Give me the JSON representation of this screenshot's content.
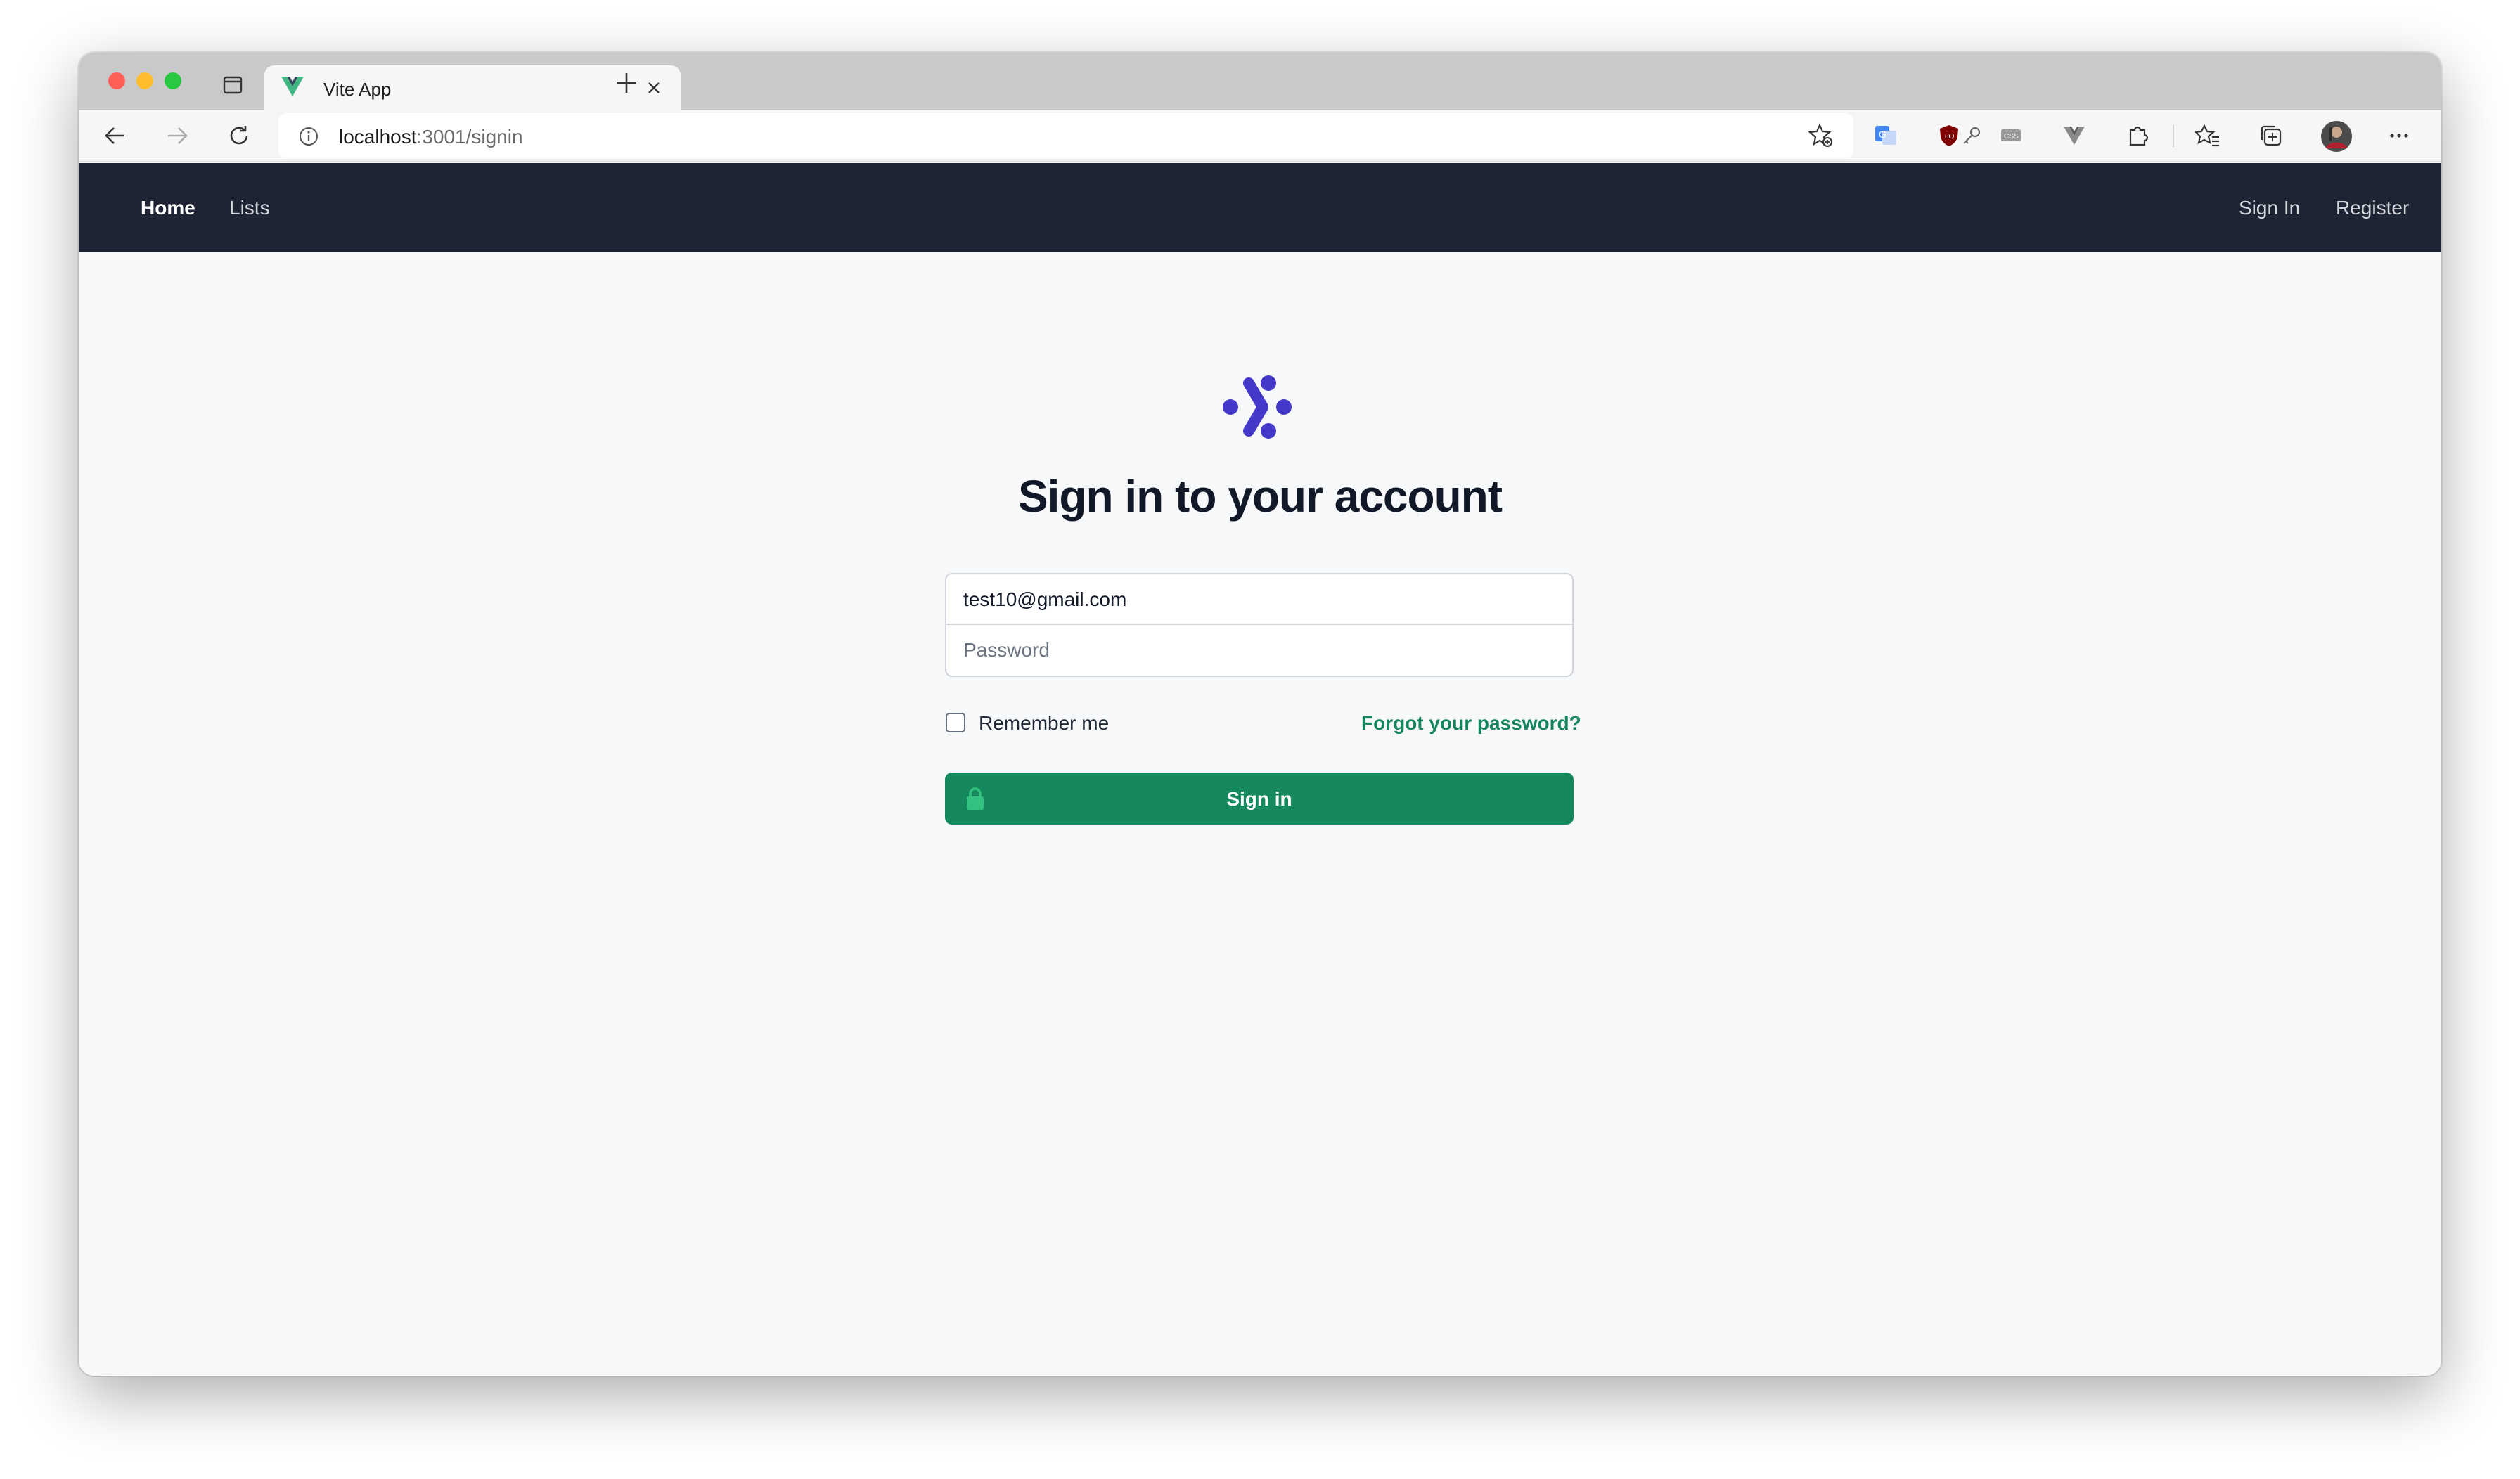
{
  "browser": {
    "tab": {
      "title": "Vite App"
    },
    "address": {
      "host": "localhost",
      "path": ":3001/signin"
    }
  },
  "navbar": {
    "home": "Home",
    "lists": "Lists",
    "sign_in": "Sign In",
    "register": "Register"
  },
  "signin": {
    "heading": "Sign in to your account",
    "email_value": "test10@gmail.com",
    "password_placeholder": "Password",
    "remember_label": "Remember me",
    "remember_checked": false,
    "forgot_link": "Forgot your password?",
    "submit_label": "Sign in"
  },
  "colors": {
    "navbar": "#1e2433",
    "accent_green": "#15895d",
    "logo_indigo": "#4338ca"
  }
}
